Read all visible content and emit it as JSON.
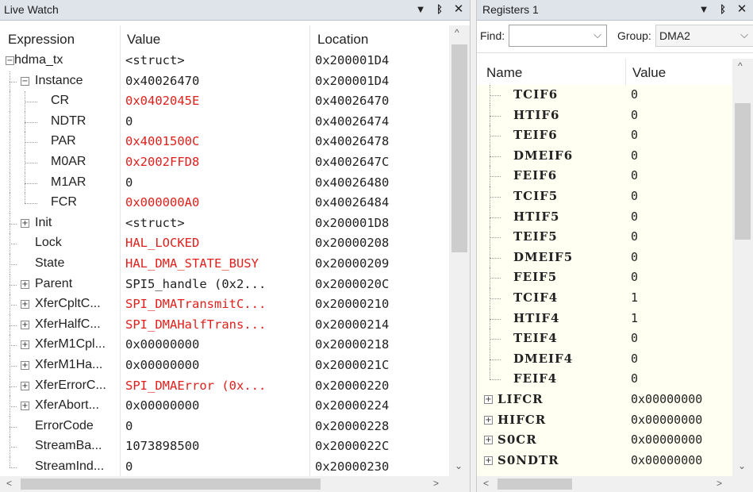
{
  "live_watch": {
    "title": "Live Watch",
    "headers": {
      "expression": "Expression",
      "value": "Value",
      "location": "Location"
    },
    "rows": [
      {
        "expr": "hdma_tx",
        "value": "<struct>",
        "loc": "0x200001D4",
        "red": false,
        "level": 0,
        "exp": "minus"
      },
      {
        "expr": "Instance",
        "value": "0x40026470",
        "loc": "0x200001D4",
        "red": false,
        "level": 1,
        "exp": "minus"
      },
      {
        "expr": "CR",
        "value": "0x0402045E",
        "loc": "0x40026470",
        "red": true,
        "level": 2,
        "exp": ""
      },
      {
        "expr": "NDTR",
        "value": "0",
        "loc": "0x40026474",
        "red": false,
        "level": 2,
        "exp": ""
      },
      {
        "expr": "PAR",
        "value": "0x4001500C",
        "loc": "0x40026478",
        "red": true,
        "level": 2,
        "exp": ""
      },
      {
        "expr": "M0AR",
        "value": "0x2002FFD8",
        "loc": "0x4002647C",
        "red": true,
        "level": 2,
        "exp": ""
      },
      {
        "expr": "M1AR",
        "value": "0",
        "loc": "0x40026480",
        "red": false,
        "level": 2,
        "exp": ""
      },
      {
        "expr": "FCR",
        "value": "0x000000A0",
        "loc": "0x40026484",
        "red": true,
        "level": 2,
        "exp": ""
      },
      {
        "expr": "Init",
        "value": "<struct>",
        "loc": "0x200001D8",
        "red": false,
        "level": 1,
        "exp": "plus"
      },
      {
        "expr": "Lock",
        "value": "HAL_LOCKED",
        "loc": "0x20000208",
        "red": true,
        "level": 1,
        "exp": ""
      },
      {
        "expr": "State",
        "value": "HAL_DMA_STATE_BUSY",
        "loc": "0x20000209",
        "red": true,
        "level": 1,
        "exp": ""
      },
      {
        "expr": "Parent",
        "value": "SPI5_handle (0x2...",
        "loc": "0x2000020C",
        "red": false,
        "level": 1,
        "exp": "plus"
      },
      {
        "expr": "XferCpltC...",
        "value": "SPI_DMATransmitC...",
        "loc": "0x20000210",
        "red": true,
        "level": 1,
        "exp": "plus"
      },
      {
        "expr": "XferHalfC...",
        "value": "SPI_DMAHalfTrans...",
        "loc": "0x20000214",
        "red": true,
        "level": 1,
        "exp": "plus"
      },
      {
        "expr": "XferM1Cpl...",
        "value": "0x00000000",
        "loc": "0x20000218",
        "red": false,
        "level": 1,
        "exp": "plus"
      },
      {
        "expr": "XferM1Ha...",
        "value": "0x00000000",
        "loc": "0x2000021C",
        "red": false,
        "level": 1,
        "exp": "plus"
      },
      {
        "expr": "XferErrorC...",
        "value": "SPI_DMAError (0x...",
        "loc": "0x20000220",
        "red": true,
        "level": 1,
        "exp": "plus"
      },
      {
        "expr": "XferAbort...",
        "value": "0x00000000",
        "loc": "0x20000224",
        "red": false,
        "level": 1,
        "exp": "plus"
      },
      {
        "expr": "ErrorCode",
        "value": "0",
        "loc": "0x20000228",
        "red": false,
        "level": 1,
        "exp": ""
      },
      {
        "expr": "StreamBa...",
        "value": "1073898500",
        "loc": "0x2000022C",
        "red": false,
        "level": 1,
        "exp": ""
      },
      {
        "expr": "StreamInd...",
        "value": "0",
        "loc": "0x20000230",
        "red": false,
        "level": 1,
        "exp": ""
      }
    ]
  },
  "registers": {
    "title": "Registers 1",
    "find_label": "Find:",
    "find_value": "",
    "group_label": "Group:",
    "group_value": "DMA2",
    "headers": {
      "name": "Name",
      "value": "Value"
    },
    "rows": [
      {
        "name": "TCIF6",
        "value": "0",
        "child": true
      },
      {
        "name": "HTIF6",
        "value": "0",
        "child": true
      },
      {
        "name": "TEIF6",
        "value": "0",
        "child": true
      },
      {
        "name": "DMEIF6",
        "value": "0",
        "child": true
      },
      {
        "name": "FEIF6",
        "value": "0",
        "child": true
      },
      {
        "name": "TCIF5",
        "value": "0",
        "child": true
      },
      {
        "name": "HTIF5",
        "value": "0",
        "child": true
      },
      {
        "name": "TEIF5",
        "value": "0",
        "child": true
      },
      {
        "name": "DMEIF5",
        "value": "0",
        "child": true
      },
      {
        "name": "FEIF5",
        "value": "0",
        "child": true
      },
      {
        "name": "TCIF4",
        "value": "1",
        "child": true
      },
      {
        "name": "HTIF4",
        "value": "1",
        "child": true
      },
      {
        "name": "TEIF4",
        "value": "0",
        "child": true
      },
      {
        "name": "DMEIF4",
        "value": "0",
        "child": true
      },
      {
        "name": "FEIF4",
        "value": "0",
        "child": true
      },
      {
        "name": "LIFCR",
        "value": "0x00000000",
        "child": false
      },
      {
        "name": "HIFCR",
        "value": "0x00000000",
        "child": false
      },
      {
        "name": "S0CR",
        "value": "0x00000000",
        "child": false
      },
      {
        "name": "S0NDTR",
        "value": "0x00000000",
        "child": false
      }
    ]
  },
  "icons": {
    "dropdown": "▼",
    "pin": "ᛒ",
    "close": "✕",
    "chevron": "⌵",
    "scroll_up": "^",
    "scroll_down": "⌄",
    "scroll_left": "<",
    "scroll_right": ">"
  }
}
